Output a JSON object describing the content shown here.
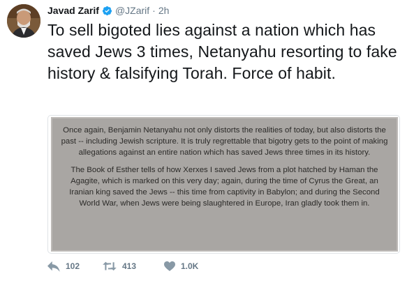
{
  "author": {
    "name": "Javad Zarif",
    "handle": "@JZarif",
    "separator": "·",
    "time": "2h"
  },
  "tweet": {
    "text": "To sell bigoted lies against a nation which has saved Jews 3 times, Netanyahu resorting to fake history & falsifying Torah. Force of habit."
  },
  "media": {
    "paragraph1": "Once again, Benjamin Netanyahu not only distorts the realities of today, but also distorts the past -- including Jewish scripture. It is truly regrettable that bigotry gets to the point of making allegations against an entire nation which has saved Jews three times in its history.",
    "paragraph2": "The Book of Esther tells of how Xerxes I saved Jews from a plot hatched by Haman the Agagite, which is marked on this very day; again, during the time of Cyrus the Great, an Iranian king saved the Jews -- this time from captivity in Babylon; and during the Second World War, when Jews were being slaughtered in Europe, Iran gladly took them in."
  },
  "actions": {
    "reply_count": "102",
    "retweet_count": "413",
    "like_count": "1.0K"
  },
  "icons": {
    "verified": "verified-badge-icon",
    "reply": "reply-icon",
    "retweet": "retweet-icon",
    "like": "heart-icon"
  },
  "colors": {
    "verified_blue": "#1da1f2",
    "secondary_text": "#657786"
  }
}
